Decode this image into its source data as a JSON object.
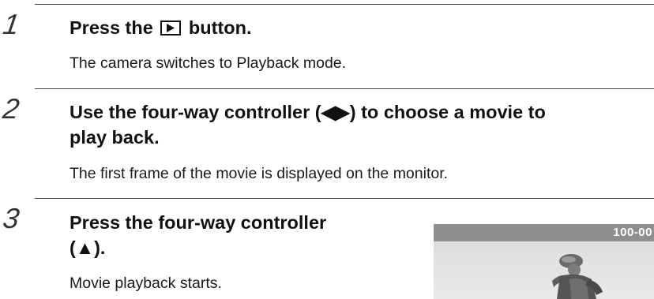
{
  "steps": [
    {
      "number": "1",
      "title_before_icon": "Press the ",
      "title_icon": "playback-button-icon",
      "title_after_icon": " button.",
      "description": "The camera switches to Playback mode."
    },
    {
      "number": "2",
      "title_line1": "Use the four-way controller (◀▶) to choose a movie to",
      "title_line2": "play back.",
      "description": "The first frame of the movie is displayed on the monitor."
    },
    {
      "number": "3",
      "title_line1": "Press the four-way controller",
      "title_line2": "(▲).",
      "description": "Movie playback starts."
    }
  ],
  "preview": {
    "file_label": "100-00",
    "image": "cyclist-photo"
  },
  "colors": {
    "rule": "#444444",
    "preview_bar": "#8f8f8f",
    "text": "#1a1a1a"
  }
}
